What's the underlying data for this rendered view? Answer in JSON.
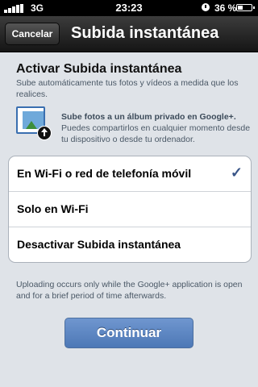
{
  "status_bar": {
    "network": "3G",
    "time": "23:23",
    "battery_percent": "36 %"
  },
  "nav": {
    "cancel_label": "Cancelar",
    "title": "Subida instantánea"
  },
  "header": {
    "heading": "Activar Subida instantánea",
    "description": "Sube automáticamente tus fotos y vídeos a medida que los realices."
  },
  "info": {
    "strong": "Sube fotos a un álbum privado en Google+.",
    "text": "Puedes compartirlos en cualquier momento desde tu dispositivo o desde tu ordenador.",
    "icon": "photo-upload-icon"
  },
  "options": [
    {
      "label": "En Wi-Fi o red de telefonía móvil",
      "selected": true
    },
    {
      "label": "Solo en Wi-Fi",
      "selected": false
    },
    {
      "label": "Desactivar Subida instantánea",
      "selected": false
    }
  ],
  "checkmark": "✓",
  "footnote": "Uploading occurs only while the Google+ application is open and for a brief period of time afterwards.",
  "continue_label": "Continuar",
  "colors": {
    "accent": "#5a82bf",
    "check": "#385487"
  }
}
